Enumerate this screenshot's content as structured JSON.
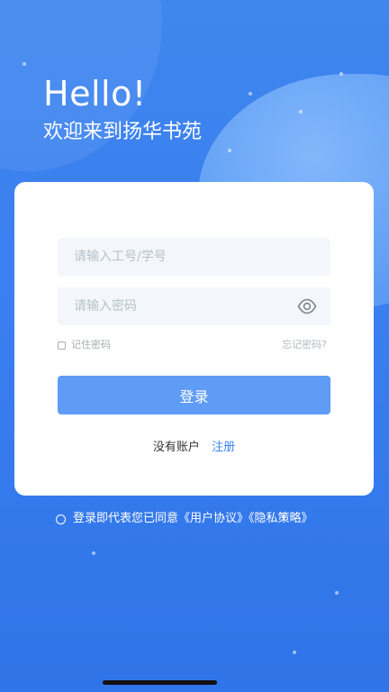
{
  "header": {
    "title": "Hello!",
    "subtitle": "欢迎来到扬华书苑"
  },
  "login_form": {
    "account_placeholder": "请输入工号/学号",
    "password_placeholder": "请输入密码",
    "remember_label": "记住密码",
    "forgot_label": "忘记密码?",
    "login_button_label": "登录",
    "no_account_label": "没有账户",
    "register_label": "注册",
    "password_visibility_icon": "eye-icon"
  },
  "agreement": {
    "text": "登录即代表您已同意《用户协议》《隐私策略》"
  },
  "colors": {
    "primary": "#3c82ee",
    "button": "#5e9cf5",
    "background": "#3f86ee"
  }
}
